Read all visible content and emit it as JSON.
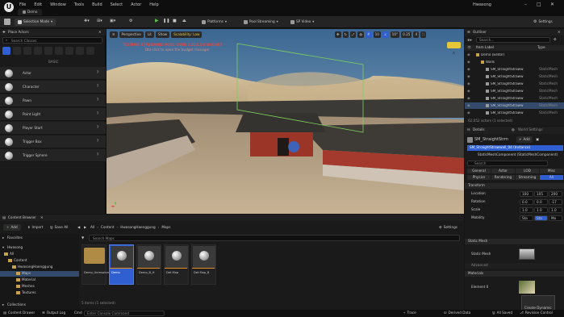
{
  "titlebar": {
    "menu": [
      "File",
      "Edit",
      "Window",
      "Tools",
      "Build",
      "Select",
      "Actor",
      "Help"
    ],
    "project_tab": "Demo",
    "project_name": "Hwasong"
  },
  "toolbar": {
    "mode": "Selection Mode",
    "platforms": "Platforms",
    "pool_streaming": "Pool Streaming",
    "sp_video": "SP Video",
    "settings": "Settings"
  },
  "place_actors": {
    "title": "Place Actors",
    "search_placeholder": "Search Classes",
    "section": "BASIC",
    "items": [
      "Actor",
      "Character",
      "Pawn",
      "Point Light",
      "Player Start",
      "Trigger Box",
      "Trigger Sphere"
    ]
  },
  "viewport": {
    "perspective": "Perspective",
    "lit": "Lit",
    "show": "Show",
    "scalability": "Scalability: Low",
    "warning_title": "TEXTURE STREAMING POOL OVER 1.014.5/8 BUDGET",
    "warning_sub": "Dbl-click to open the budget manager",
    "toolbar_right": [
      "10",
      "10°",
      "0.25",
      "4"
    ]
  },
  "outliner": {
    "title": "Outliner",
    "search_placeholder": "Search...",
    "col_label": "Item Label",
    "col_type": "Type",
    "items": [
      {
        "name": "Demo (Editor)",
        "type": "",
        "indent": 0
      },
      {
        "name": "Walls",
        "type": "",
        "indent": 1
      },
      {
        "name": "SM_StraightStraww",
        "type": "StaticMesh",
        "indent": 2
      },
      {
        "name": "SM_StraightStraww",
        "type": "StaticMesh",
        "indent": 2
      },
      {
        "name": "SM_StraightStraww",
        "type": "StaticMesh",
        "indent": 2
      },
      {
        "name": "SM_StraightStraww",
        "type": "StaticMesh",
        "indent": 2
      },
      {
        "name": "SM_StraightStraww",
        "type": "StaticMesh",
        "indent": 2
      },
      {
        "name": "SM_StraightStraww",
        "type": "StaticMesh",
        "indent": 2
      },
      {
        "name": "SM_StraightStraww",
        "type": "StaticMesh",
        "indent": 2
      }
    ],
    "count": "62,052 actors (1 selected)"
  },
  "details": {
    "title": "Details",
    "world_settings": "World Settings",
    "actor": "SM_StraightStrm",
    "add": "Add",
    "instance": "SM_StraightStrawwall_04 (Instance)",
    "component": "StaticMeshComponent (StaticMeshComponent)",
    "search_placeholder": "Search",
    "tabs1": [
      "General",
      "Actor",
      "LOD",
      "Misc"
    ],
    "tabs2": [
      "Physics",
      "Rendering",
      "Streaming",
      "All"
    ],
    "transform": "Transform",
    "location": "Location",
    "rotation": "Rotation",
    "scale": "Scale",
    "mobility": "Mobility",
    "loc": [
      "100",
      "105",
      "200"
    ],
    "rot": [
      "0.0",
      "0.0",
      "-17"
    ],
    "scl": [
      "1.0",
      "1.0",
      "1.0"
    ],
    "mob": [
      "Sta",
      "Sta",
      "Mo"
    ],
    "static_mesh_section": "Static Mesh",
    "static_mesh_label": "Static Mesh",
    "advanced": "Advanced",
    "materials": "Materials",
    "element": "Element 0",
    "create_dynamic": "Create Dynamic"
  },
  "content_browser": {
    "title": "Content Browser",
    "add": "Add",
    "import": "Import",
    "save_all": "Save All",
    "path": [
      "All",
      "Content",
      "HwasongHaenggung",
      "Maps"
    ],
    "settings": "Settings",
    "search_placeholder": "Search Maps",
    "favorites": "Favorites",
    "project": "Hwasong",
    "collections": "Collections",
    "tree": [
      {
        "label": "All",
        "indent": 0
      },
      {
        "label": "Content",
        "indent": 1
      },
      {
        "label": "HwasongHaenggung",
        "indent": 2
      },
      {
        "label": "Maps",
        "indent": 3
      },
      {
        "label": "Material",
        "indent": 3
      },
      {
        "label": "Meshes",
        "indent": 3
      },
      {
        "label": "Textures",
        "indent": 3
      }
    ],
    "assets": [
      {
        "label": "Demo_Unresolved",
        "type": "folder"
      },
      {
        "label": "Demo",
        "type": "level"
      },
      {
        "label": "Demo_B_H",
        "type": "level"
      },
      {
        "label": "Det Map",
        "type": "level"
      },
      {
        "label": "Det Map_B",
        "type": "level"
      }
    ],
    "status": "5 items (1 selected)"
  },
  "statusbar": {
    "content_drawer": "Content Drawer",
    "output_log": "Output Log",
    "cmd": "Cmd",
    "cmd_placeholder": "Enter Console Command",
    "trace": "Trace",
    "derived_data": "Derived Data",
    "all_saved": "All Saved",
    "revision_control": "Revision Control"
  }
}
